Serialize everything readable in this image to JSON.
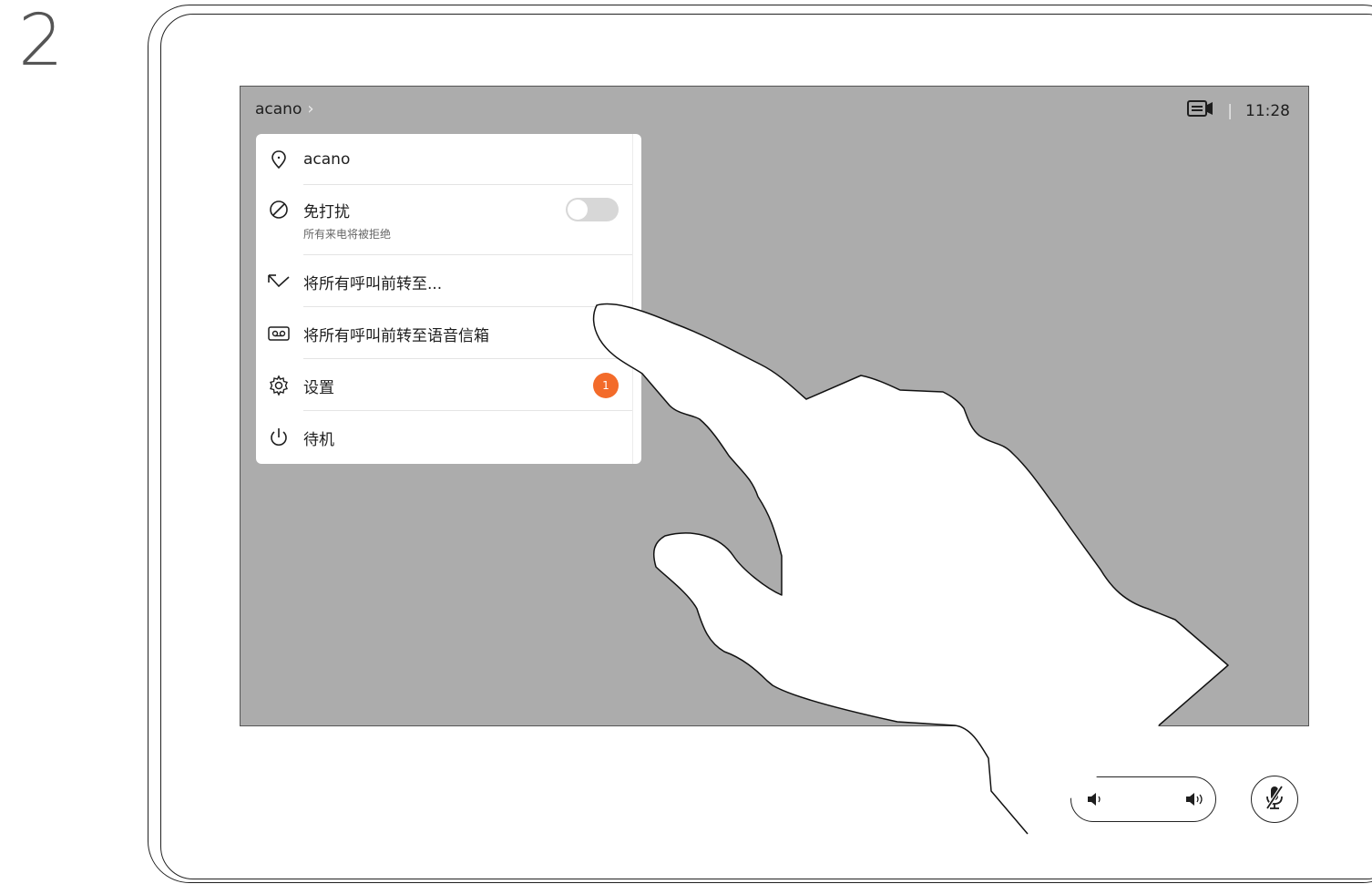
{
  "step": {
    "number": "2"
  },
  "header": {
    "breadcrumb": "acano",
    "separator": "|",
    "time": "11:28"
  },
  "menu": {
    "items": [
      {
        "label": "acano",
        "icon": "location-pin-icon"
      },
      {
        "label": "免打扰",
        "sublabel": "所有来电将被拒绝",
        "icon": "do-not-disturb-icon",
        "toggle": false
      },
      {
        "label": "将所有呼叫前转至...",
        "icon": "call-forward-icon"
      },
      {
        "label": "将所有呼叫前转至语音信箱",
        "icon": "voicemail-icon"
      },
      {
        "label": "设置",
        "icon": "gear-icon",
        "badge": "1"
      },
      {
        "label": "待机",
        "icon": "power-icon"
      }
    ]
  },
  "controls": {
    "volume_icons": [
      "volume-down-icon",
      "volume-up-icon"
    ],
    "mute_icon": "microphone-muted-icon"
  },
  "colors": {
    "screen_bg": "#acacac",
    "badge": "#f36b2a"
  }
}
